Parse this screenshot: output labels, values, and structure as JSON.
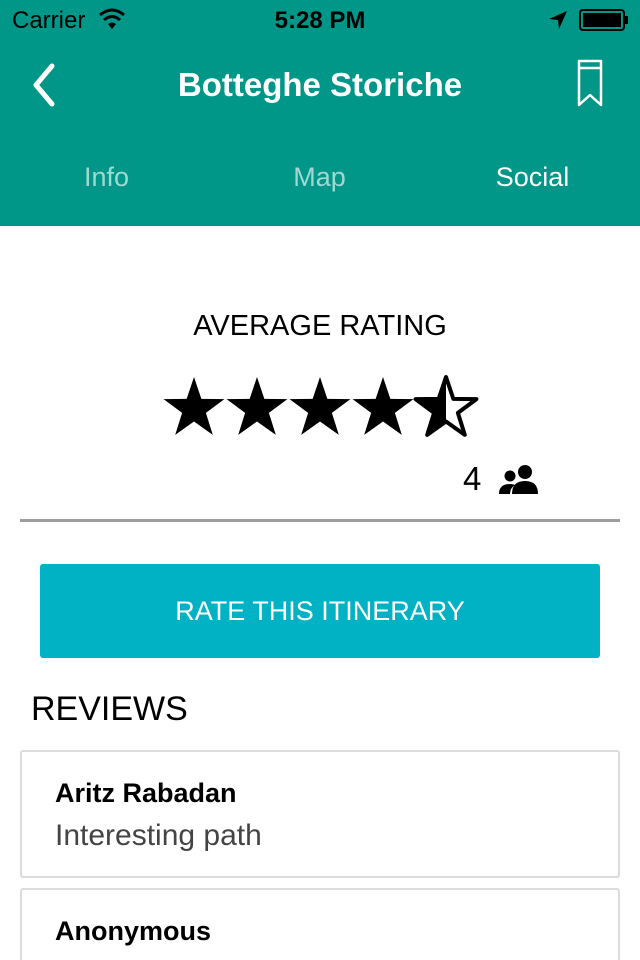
{
  "status_bar": {
    "carrier": "Carrier",
    "time": "5:28 PM"
  },
  "nav": {
    "title": "Botteghe Storiche"
  },
  "tabs": [
    {
      "label": "Info",
      "active": false
    },
    {
      "label": "Map",
      "active": false
    },
    {
      "label": "Social",
      "active": true
    }
  ],
  "rating": {
    "label": "AVERAGE RATING",
    "value": 4.5,
    "max": 5,
    "count": "4"
  },
  "rate_button": {
    "label": "RATE THIS ITINERARY"
  },
  "reviews": {
    "title": "REVIEWS",
    "items": [
      {
        "author": "Aritz Rabadan",
        "text": "Interesting path"
      },
      {
        "author": "Anonymous",
        "text": ""
      }
    ]
  },
  "colors": {
    "header": "#009688",
    "tab_active": "#ffffff",
    "tab_inactive": "#9fd9d2",
    "button": "#00b2c3"
  },
  "icons": {
    "back": "chevron-left-icon",
    "bookmark": "bookmark-icon",
    "star": "star-icon",
    "people": "people-icon"
  }
}
